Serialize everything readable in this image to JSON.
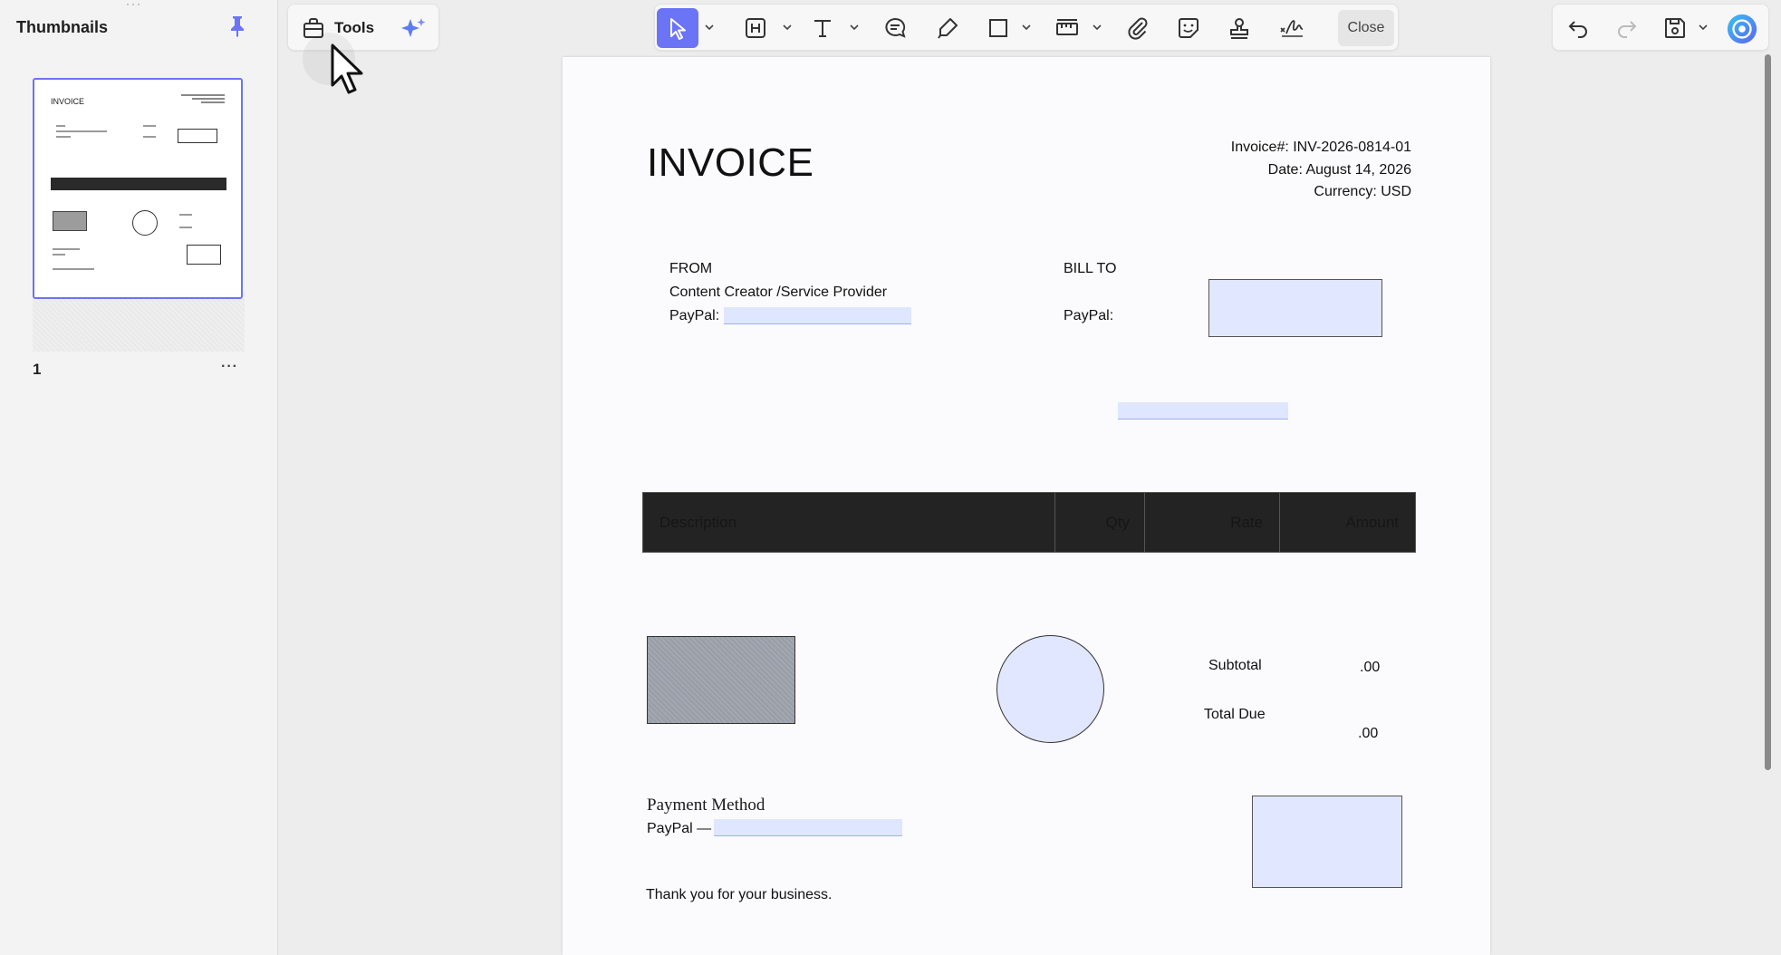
{
  "sidebar": {
    "title": "Thumbnails",
    "thumbnail": {
      "page_number": "1",
      "title": "INVOICE"
    }
  },
  "toolbar": {
    "tools_label": "Tools",
    "close_label": "Close",
    "accent": "#6b74f5",
    "items": [
      "select-icon",
      "text-box-icon",
      "text-icon",
      "comment-icon",
      "highlighter-icon",
      "shape-icon",
      "measure-icon",
      "attachment-icon",
      "sticker-icon",
      "stamp-icon",
      "signature-icon"
    ]
  },
  "document": {
    "title": "INVOICE",
    "invoice_number": "Invoice#: INV-2026-0814-01",
    "date": "Date: August 14, 2026",
    "currency": "Currency: USD",
    "from_label": "FROM",
    "from_name": "Content Creator /Service Provider",
    "from_paypal_label": "PayPal:",
    "bill_to_label": "BILL TO",
    "bill_to_paypal_label": "PayPal:",
    "table_headers": [
      "Description",
      "Qty",
      "Rate",
      "Amount"
    ],
    "subtotal_label": "Subtotal",
    "subtotal_value": ".00",
    "total_due_label": "Total Due",
    "total_due_value": ".00",
    "payment_method_label": "Payment Method",
    "payment_paypal_label": "PayPal —",
    "thank_you": "Thank you for your business."
  }
}
